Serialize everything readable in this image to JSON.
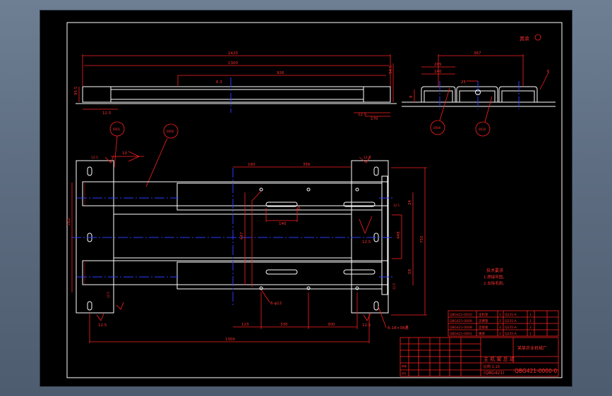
{
  "drawing": {
    "surface_note": "其余",
    "dims": {
      "overall_length": "1420",
      "inner_length": "1300",
      "mid_span": "926",
      "left_height": "95.5",
      "right_height": "94.5",
      "bottom_left": "12.5",
      "bottom_right": "12.5",
      "right_offset": "170",
      "side_width": "367",
      "side_inner": "205",
      "side_140": "140",
      "side_25": "25",
      "plan_160": "160",
      "plan_356": "356",
      "plan_140": "140",
      "plan_123": "123",
      "plan_330": "330",
      "plan_300": "300",
      "plan_1300": "1300",
      "plan_left_v": "162",
      "plan_447": "447",
      "plan_24": "24",
      "plan_58": "58",
      "plan_750": "750",
      "plan_448": "448",
      "plan_28": "28",
      "plan_25": "12.5",
      "plan_10": "10",
      "hole_note_1": "6-φ12",
      "hole_note_2": "6-18×38通",
      "roughness_1": "12.5",
      "roughness_2": "12.5",
      "roughness_3": "12.5"
    },
    "balloons": [
      "0001",
      "0000",
      "0000",
      "0010"
    ],
    "tech_req": {
      "title": "技术要求",
      "line1": "1.焊接牢固。",
      "line2": "2.去除毛刺。"
    },
    "title_block": {
      "company": "某某农业机械厂",
      "part_name": "主 机 架 总 成",
      "code": "QBG421-0000-0",
      "material": "(QBG421)",
      "scale_label": "比例 1:10"
    },
    "bom": [
      [
        "QBG421-0010",
        "主机架",
        "1",
        "Q235-A",
        "1",
        ""
      ],
      [
        "QBG421-0009",
        "支撑管",
        "2",
        "Q235-A",
        "2",
        ""
      ],
      [
        "QBG421-0008",
        "连接板",
        "2",
        "Q235-A",
        "2",
        ""
      ],
      [
        "QBG421-0001",
        "横梁",
        "1",
        "Q235-A",
        "1",
        ""
      ]
    ]
  }
}
